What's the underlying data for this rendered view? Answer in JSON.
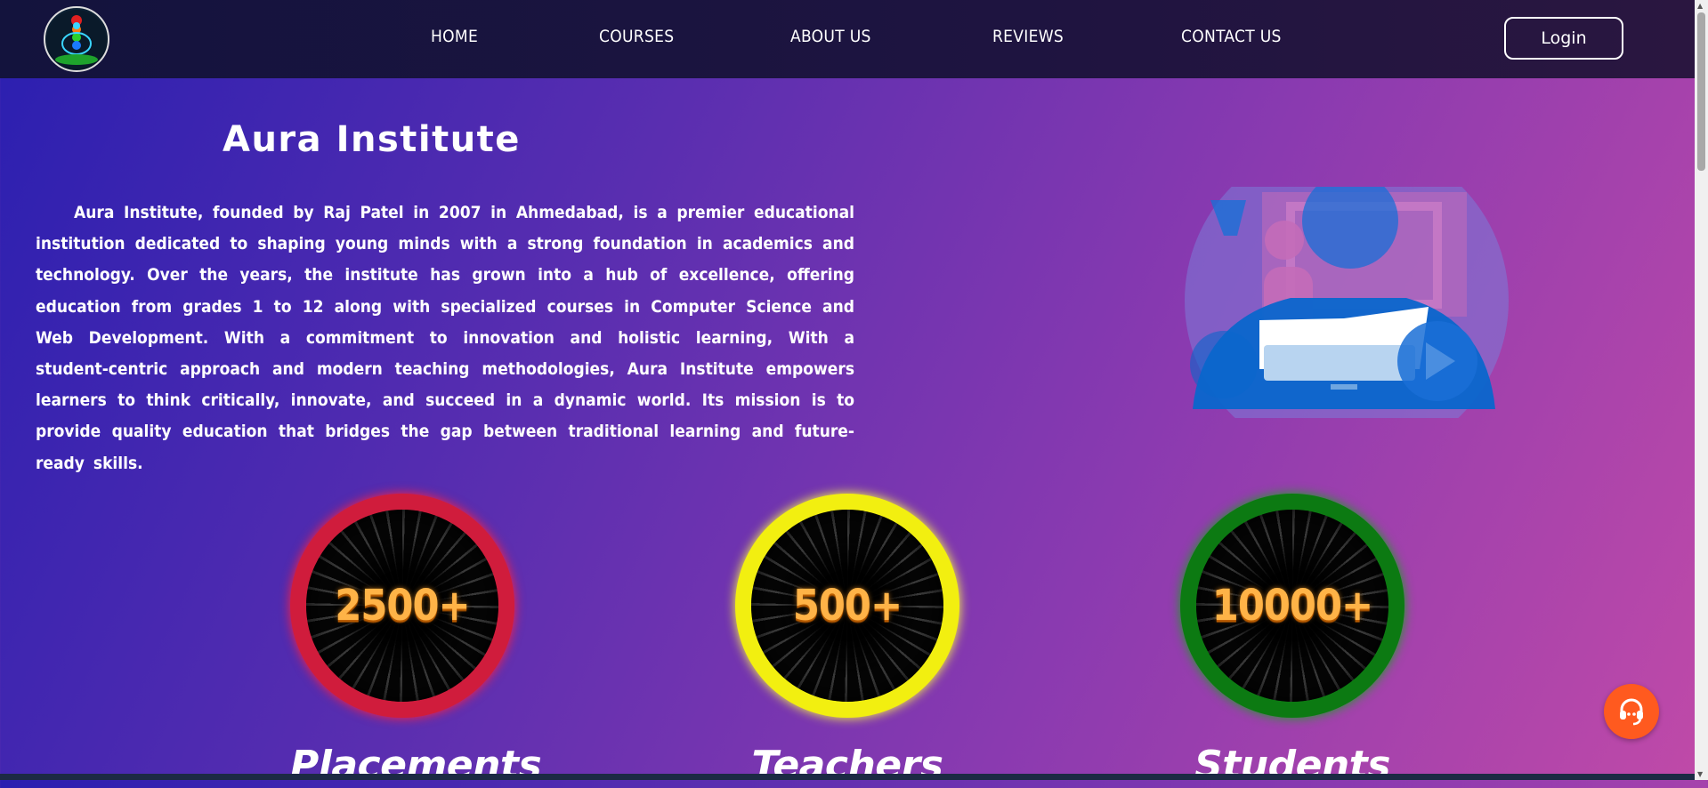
{
  "nav": {
    "logo_alt": "",
    "links": [
      "HOME",
      "COURSES",
      "ABOUT US",
      "REVIEWS",
      "CONTACT US"
    ],
    "login_label": "Login"
  },
  "hero": {
    "title": "Aura Institute",
    "description": "Aura Institute, founded by Raj Patel in 2007 in Ahmedabad, is a premier educational institution dedicated to shaping young minds with a strong foundation in academics and technology. Over the years, the institute has grown into a hub of excellence, offering education from grades 1 to 12 along with specialized courses in Computer Science and Web Development. With a commitment to innovation and holistic learning, With a student-centric approach and modern teaching methodologies, Aura Institute empowers learners to think critically, innovate, and succeed in a dynamic world. Its mission is to provide quality education that bridges the gap between traditional learning and future-ready skills.",
    "illustration_icon": "online-learning-icon"
  },
  "stats": [
    {
      "value": "2500+",
      "label": "Placements",
      "ring_color": "#d01c3c"
    },
    {
      "value": "500+",
      "label": "Teachers",
      "ring_color": "#f2ef10"
    },
    {
      "value": "10000+",
      "label": "Students",
      "ring_color": "#0c7a12"
    }
  ],
  "support": {
    "icon": "headset-icon"
  },
  "colors": {
    "nav_bg": "#1a1440",
    "support_bg": "#ff5a1f",
    "stat_number": "#ffb347"
  }
}
